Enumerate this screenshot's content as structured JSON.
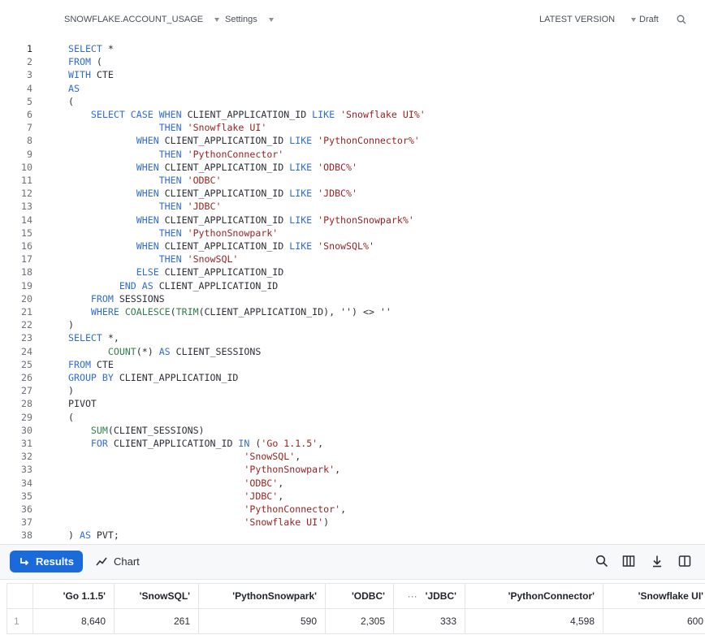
{
  "topbar": {
    "schema": "SNOWFLAKE.ACCOUNT_USAGE",
    "settings": "Settings",
    "version": "LATEST VERSION",
    "status": "Draft",
    "search_icon": "search-icon"
  },
  "editor": {
    "lines": [
      [
        [
          "kw",
          "SELECT"
        ],
        [
          "p",
          " *"
        ]
      ],
      [
        [
          "kw",
          "FROM"
        ],
        [
          "p",
          " ("
        ]
      ],
      [
        [
          "kw",
          "WITH"
        ],
        [
          "p",
          " CTE"
        ]
      ],
      [
        [
          "kw",
          "AS"
        ]
      ],
      [
        [
          "p",
          "("
        ]
      ],
      [
        [
          "p",
          "    "
        ],
        [
          "kw",
          "SELECT CASE WHEN"
        ],
        [
          "p",
          " CLIENT_APPLICATION_ID "
        ],
        [
          "kw",
          "LIKE"
        ],
        [
          "p",
          " "
        ],
        [
          "str",
          "'Snowflake UI%'"
        ]
      ],
      [
        [
          "p",
          "                "
        ],
        [
          "kw",
          "THEN"
        ],
        [
          "p",
          " "
        ],
        [
          "str",
          "'Snowflake UI'"
        ]
      ],
      [
        [
          "p",
          "            "
        ],
        [
          "kw",
          "WHEN"
        ],
        [
          "p",
          " CLIENT_APPLICATION_ID "
        ],
        [
          "kw",
          "LIKE"
        ],
        [
          "p",
          " "
        ],
        [
          "str",
          "'PythonConnector%'"
        ]
      ],
      [
        [
          "p",
          "                "
        ],
        [
          "kw",
          "THEN"
        ],
        [
          "p",
          " "
        ],
        [
          "str",
          "'PythonConnector'"
        ]
      ],
      [
        [
          "p",
          "            "
        ],
        [
          "kw",
          "WHEN"
        ],
        [
          "p",
          " CLIENT_APPLICATION_ID "
        ],
        [
          "kw",
          "LIKE"
        ],
        [
          "p",
          " "
        ],
        [
          "str",
          "'ODBC%'"
        ]
      ],
      [
        [
          "p",
          "                "
        ],
        [
          "kw",
          "THEN"
        ],
        [
          "p",
          " "
        ],
        [
          "str",
          "'ODBC'"
        ]
      ],
      [
        [
          "p",
          "            "
        ],
        [
          "kw",
          "WHEN"
        ],
        [
          "p",
          " CLIENT_APPLICATION_ID "
        ],
        [
          "kw",
          "LIKE"
        ],
        [
          "p",
          " "
        ],
        [
          "str",
          "'JDBC%'"
        ]
      ],
      [
        [
          "p",
          "                "
        ],
        [
          "kw",
          "THEN"
        ],
        [
          "p",
          " "
        ],
        [
          "str",
          "'JDBC'"
        ]
      ],
      [
        [
          "p",
          "            "
        ],
        [
          "kw",
          "WHEN"
        ],
        [
          "p",
          " CLIENT_APPLICATION_ID "
        ],
        [
          "kw",
          "LIKE"
        ],
        [
          "p",
          " "
        ],
        [
          "str",
          "'PythonSnowpark%'"
        ]
      ],
      [
        [
          "p",
          "                "
        ],
        [
          "kw",
          "THEN"
        ],
        [
          "p",
          " "
        ],
        [
          "str",
          "'PythonSnowpark'"
        ]
      ],
      [
        [
          "p",
          "            "
        ],
        [
          "kw",
          "WHEN"
        ],
        [
          "p",
          " CLIENT_APPLICATION_ID "
        ],
        [
          "kw",
          "LIKE"
        ],
        [
          "p",
          " "
        ],
        [
          "str",
          "'SnowSQL%'"
        ]
      ],
      [
        [
          "p",
          "                "
        ],
        [
          "kw",
          "THEN"
        ],
        [
          "p",
          " "
        ],
        [
          "str",
          "'SnowSQL'"
        ]
      ],
      [
        [
          "p",
          "            "
        ],
        [
          "kw",
          "ELSE"
        ],
        [
          "p",
          " CLIENT_APPLICATION_ID"
        ]
      ],
      [
        [
          "p",
          "         "
        ],
        [
          "kw",
          "END AS"
        ],
        [
          "p",
          " CLIENT_APPLICATION_ID"
        ]
      ],
      [
        [
          "p",
          "    "
        ],
        [
          "kw",
          "FROM"
        ],
        [
          "p",
          " SESSIONS"
        ]
      ],
      [
        [
          "p",
          "    "
        ],
        [
          "kw",
          "WHERE"
        ],
        [
          "p",
          " "
        ],
        [
          "fn",
          "COALESCE"
        ],
        [
          "p",
          "("
        ],
        [
          "fn",
          "TRIM"
        ],
        [
          "p",
          "(CLIENT_APPLICATION_ID), '') <> ''"
        ]
      ],
      [
        [
          "p",
          ")"
        ]
      ],
      [
        [
          "kw",
          "SELECT"
        ],
        [
          "p",
          " *,"
        ]
      ],
      [
        [
          "p",
          "       "
        ],
        [
          "fn",
          "COUNT"
        ],
        [
          "p",
          "(*) "
        ],
        [
          "kw",
          "AS"
        ],
        [
          "p",
          " CLIENT_SESSIONS"
        ]
      ],
      [
        [
          "kw",
          "FROM"
        ],
        [
          "p",
          " CTE"
        ]
      ],
      [
        [
          "kw",
          "GROUP BY"
        ],
        [
          "p",
          " CLIENT_APPLICATION_ID"
        ]
      ],
      [
        [
          "p",
          ")"
        ]
      ],
      [
        [
          "p",
          "PIVOT"
        ]
      ],
      [
        [
          "p",
          "("
        ]
      ],
      [
        [
          "p",
          "    "
        ],
        [
          "fn",
          "SUM"
        ],
        [
          "p",
          "(CLIENT_SESSIONS)"
        ]
      ],
      [
        [
          "p",
          "    "
        ],
        [
          "kw",
          "FOR"
        ],
        [
          "p",
          " CLIENT_APPLICATION_ID "
        ],
        [
          "kw",
          "IN"
        ],
        [
          "p",
          " ("
        ],
        [
          "str",
          "'Go 1.1.5'"
        ],
        [
          "p",
          ","
        ]
      ],
      [
        [
          "p",
          "                               "
        ],
        [
          "str",
          "'SnowSQL'"
        ],
        [
          "p",
          ","
        ]
      ],
      [
        [
          "p",
          "                               "
        ],
        [
          "str",
          "'PythonSnowpark'"
        ],
        [
          "p",
          ","
        ]
      ],
      [
        [
          "p",
          "                               "
        ],
        [
          "str",
          "'ODBC'"
        ],
        [
          "p",
          ","
        ]
      ],
      [
        [
          "p",
          "                               "
        ],
        [
          "str",
          "'JDBC'"
        ],
        [
          "p",
          ","
        ]
      ],
      [
        [
          "p",
          "                               "
        ],
        [
          "str",
          "'PythonConnector'"
        ],
        [
          "p",
          ","
        ]
      ],
      [
        [
          "p",
          "                               "
        ],
        [
          "str",
          "'Snowflake UI'"
        ],
        [
          "p",
          ")"
        ]
      ],
      [
        [
          "p",
          ") "
        ],
        [
          "kw",
          "AS"
        ],
        [
          "p",
          " PVT;"
        ]
      ]
    ]
  },
  "results": {
    "results_label": "Results",
    "chart_label": "Chart",
    "toolbar_icons": [
      "search-icon",
      "columns-icon",
      "download-icon",
      "split-panel-icon"
    ]
  },
  "table": {
    "headers": [
      "",
      "'Go 1.1.5'",
      "'SnowSQL'",
      "'PythonSnowpark'",
      "'ODBC'",
      "'JDBC'",
      "'PythonConnector'",
      "'Snowflake UI'"
    ],
    "ellipsis": "···",
    "rows": [
      [
        "1",
        "8,640",
        "261",
        "590",
        "2,305",
        "333",
        "4,598",
        "600"
      ]
    ]
  }
}
